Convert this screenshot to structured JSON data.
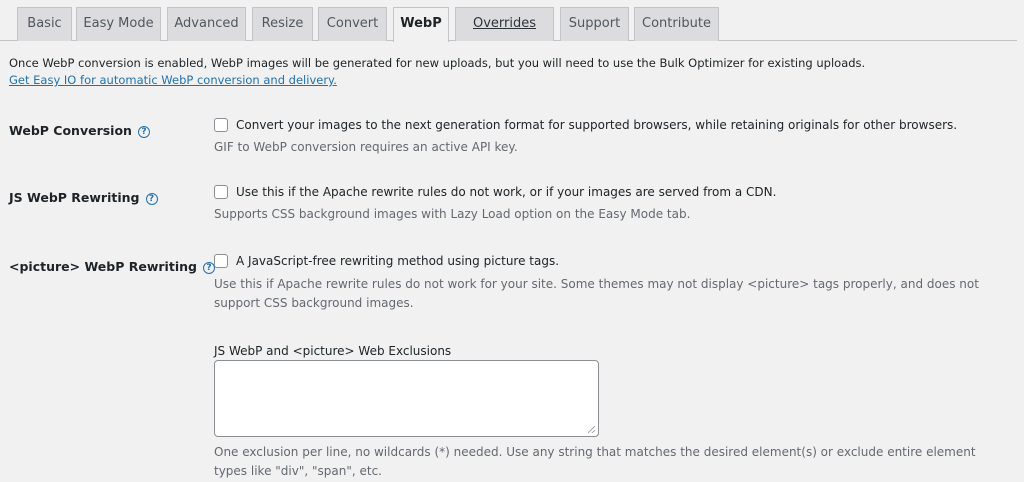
{
  "tabs": [
    {
      "label": "Basic"
    },
    {
      "label": "Easy Mode"
    },
    {
      "label": "Advanced"
    },
    {
      "label": "Resize"
    },
    {
      "label": "Convert"
    },
    {
      "label": "WebP"
    },
    {
      "label": "Overrides"
    },
    {
      "label": "Support"
    },
    {
      "label": "Contribute"
    }
  ],
  "active_tab": "WebP",
  "intro": {
    "text": "Once WebP conversion is enabled, WebP images will be generated for new uploads, but you will need to use the Bulk Optimizer for existing uploads.",
    "link": "Get Easy IO for automatic WebP conversion and delivery."
  },
  "settings": {
    "webp_conversion": {
      "label": "WebP Conversion",
      "checkbox_label": "Convert your images to the next generation format for supported browsers, while retaining originals for other browsers.",
      "checked": false,
      "description": "GIF to WebP conversion requires an active API key."
    },
    "js_webp": {
      "label": "JS WebP Rewriting",
      "checkbox_label": "Use this if the Apache rewrite rules do not work, or if your images are served from a CDN.",
      "checked": false,
      "description": "Supports CSS background images with Lazy Load option on the Easy Mode tab."
    },
    "picture_webp": {
      "label": "<picture> WebP Rewriting",
      "checkbox_label": "A JavaScript-free rewriting method using picture tags.",
      "checked": false,
      "description": "Use this if Apache rewrite rules do not work for your site. Some themes may not display <picture> tags properly, and does not support CSS background images."
    },
    "exclusions": {
      "label": "JS WebP and <picture> Web Exclusions",
      "value": "",
      "description": "One exclusion per line, no wildcards (*) needed. Use any string that matches the desired element(s) or exclude entire element types like \"div\", \"span\", etc."
    }
  },
  "icons": {
    "help": "question-circle-icon"
  },
  "colors": {
    "link": "#2271b1",
    "background": "#f1f1f1",
    "tab_inactive": "#dcdcde"
  }
}
